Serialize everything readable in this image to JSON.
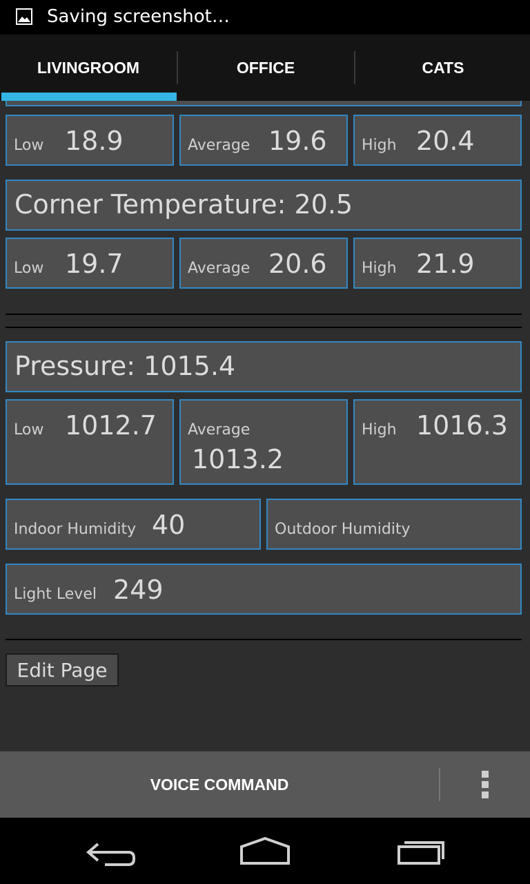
{
  "status_bar": {
    "notification_icon": "image-icon",
    "text": "Saving screenshot…"
  },
  "tabs": [
    {
      "label": "LIVINGROOM",
      "selected": true
    },
    {
      "label": "OFFICE",
      "selected": false
    },
    {
      "label": "CATS",
      "selected": false
    }
  ],
  "colors": {
    "accent": "#33b5e5",
    "box_border": "#3288c4",
    "box_bg": "#4e4e4e",
    "background": "#2d2d2d"
  },
  "first_sensor": {
    "low_label": "Low",
    "low_value": "18.9",
    "avg_label": "Average",
    "avg_value": "19.6",
    "high_label": "High",
    "high_value": "20.4"
  },
  "corner": {
    "title": "Corner Temperature: 20.5",
    "low_label": "Low",
    "low_value": "19.7",
    "avg_label": "Average",
    "avg_value": "20.6",
    "high_label": "High",
    "high_value": "21.9"
  },
  "pressure": {
    "title": "Pressure: 1015.4",
    "low_label": "Low",
    "low_value": "1012.7",
    "avg_label": "Average",
    "avg_value": "1013.2",
    "high_label": "High",
    "high_value": "1016.3"
  },
  "humidity": {
    "indoor_label": "Indoor Humidity",
    "indoor_value": "40",
    "outdoor_label": "Outdoor Humidity",
    "outdoor_value": ""
  },
  "light": {
    "label": "Light Level",
    "value": "249"
  },
  "edit_button": "Edit Page",
  "action_bar": {
    "voice_command": "VOICE COMMAND",
    "overflow_icon": "overflow-menu-icon"
  },
  "nav_bar": {
    "back": "back-icon",
    "home": "home-icon",
    "recents": "recents-icon"
  }
}
